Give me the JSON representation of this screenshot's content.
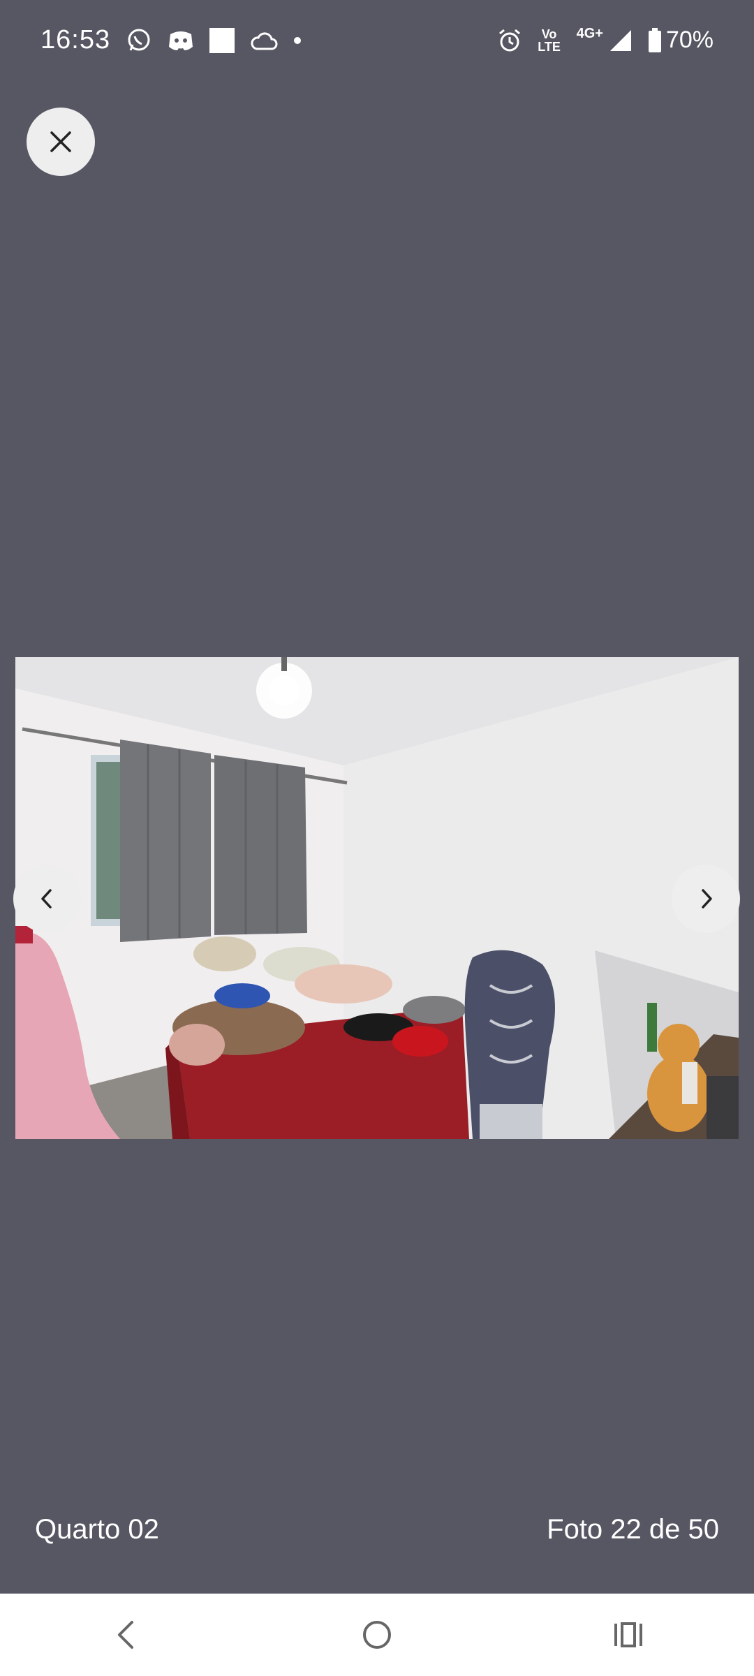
{
  "status_bar": {
    "time": "16:53",
    "left_icons": [
      "whatsapp-icon",
      "discord-icon",
      "square-notification-icon",
      "cloud-icon",
      "dot-icon"
    ],
    "network_volte": "Vo LTE",
    "network_type": "4G+",
    "battery_percent": "70%"
  },
  "viewer": {
    "photo_caption": "Quarto 02",
    "photo_counter": "Foto 22 de 50"
  },
  "colors": {
    "background": "#575764",
    "button_bg": "#eeeeef",
    "nav_bar": "#ffffff"
  }
}
